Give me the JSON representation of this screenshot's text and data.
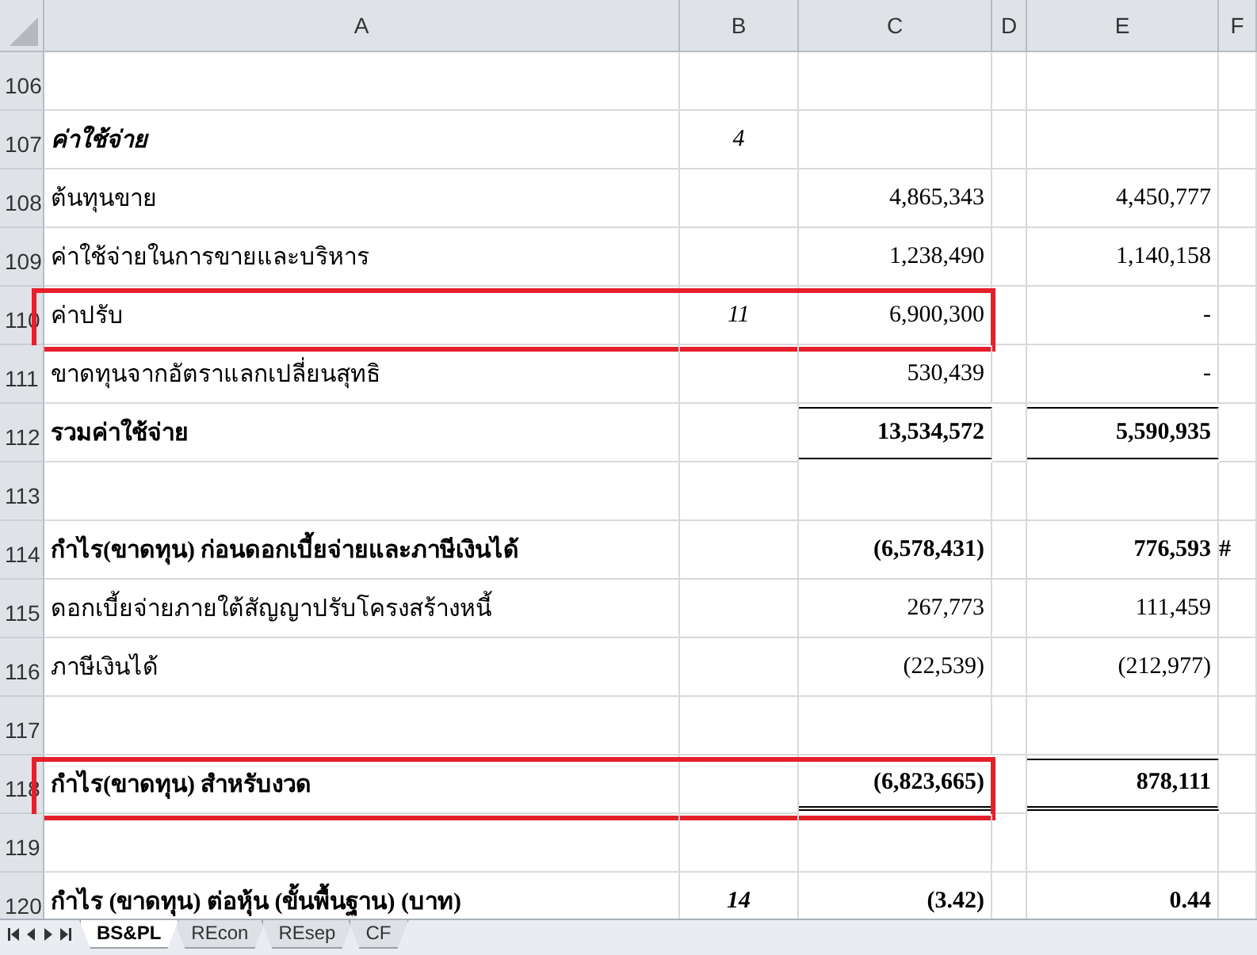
{
  "columns": [
    "A",
    "B",
    "C",
    "D",
    "E",
    "F"
  ],
  "rows": [
    {
      "number": "106",
      "kind": "item",
      "a": "",
      "b": "",
      "c": "",
      "e": "",
      "highlighted": false
    },
    {
      "number": "107",
      "kind": "heading",
      "a": "ค่าใช้จ่าย",
      "b": "4",
      "c": "",
      "e": "",
      "highlighted": false
    },
    {
      "number": "108",
      "kind": "item",
      "a": "ต้นทุนขาย",
      "b": "",
      "c": "4,865,343",
      "e": "4,450,777",
      "highlighted": false
    },
    {
      "number": "109",
      "kind": "item",
      "a": "ค่าใช้จ่ายในการขายและบริหาร",
      "b": "",
      "c": "1,238,490",
      "e": "1,140,158",
      "highlighted": false
    },
    {
      "number": "110",
      "kind": "item",
      "a": "ค่าปรับ",
      "b": "11",
      "c": "6,900,300",
      "e": "-",
      "highlighted": true
    },
    {
      "number": "111",
      "kind": "item",
      "a": "ขาดทุนจากอัตราแลกเปลี่ยนสุทธิ",
      "b": "",
      "c": "530,439",
      "e": "-",
      "highlighted": false
    },
    {
      "number": "112",
      "kind": "subtotal",
      "a": "รวมค่าใช้จ่าย",
      "b": "",
      "c": "13,534,572",
      "e": "5,590,935",
      "highlighted": false
    },
    {
      "number": "113",
      "kind": "item",
      "a": "",
      "b": "",
      "c": "",
      "e": "",
      "highlighted": false
    },
    {
      "number": "114",
      "kind": "bold",
      "a": "กำไร(ขาดทุน) ก่อนดอกเบี้ยจ่ายและภาษีเงินได้",
      "b": "",
      "c": "(6,578,431)",
      "e": "776,593",
      "f": "#",
      "highlighted": false
    },
    {
      "number": "115",
      "kind": "item",
      "a": "ดอกเบี้ยจ่ายภายใต้สัญญาปรับโครงสร้างหนี้",
      "b": "",
      "c": "267,773",
      "e": "111,459",
      "highlighted": false
    },
    {
      "number": "116",
      "kind": "item",
      "a": "ภาษีเงินได้",
      "b": "",
      "c": "(22,539)",
      "e": "(212,977)",
      "highlighted": false
    },
    {
      "number": "117",
      "kind": "item",
      "a": "",
      "b": "",
      "c": "",
      "e": "",
      "highlighted": false
    },
    {
      "number": "118",
      "kind": "total",
      "a": "กำไร(ขาดทุน) สำหรับงวด",
      "b": "",
      "c": "(6,823,665)",
      "e": "878,111",
      "highlighted": true
    },
    {
      "number": "119",
      "kind": "item",
      "a": "",
      "b": "",
      "c": "",
      "e": "",
      "highlighted": false
    },
    {
      "number": "120",
      "kind": "bold",
      "a": "กำไร (ขาดทุน) ต่อหุ้น (ขั้นพื้นฐาน) (บาท)",
      "b": "14",
      "c": "(3.42)",
      "e": "0.44",
      "highlighted": false
    }
  ],
  "sheet_tabs": [
    {
      "label": "BS&PL",
      "selected": true
    },
    {
      "label": "REcon",
      "selected": false
    },
    {
      "label": "REsep",
      "selected": false
    },
    {
      "label": "CF",
      "selected": false
    }
  ]
}
